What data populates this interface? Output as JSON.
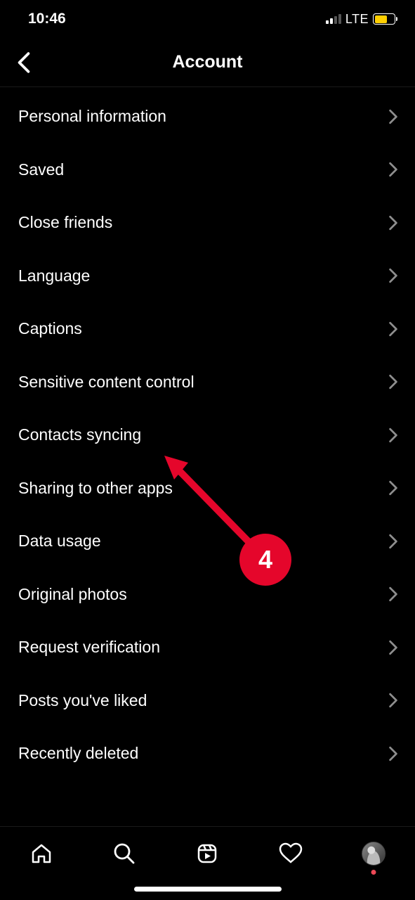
{
  "status": {
    "time": "10:46",
    "network": "LTE"
  },
  "header": {
    "title": "Account"
  },
  "items": [
    {
      "label": "Personal information"
    },
    {
      "label": "Saved"
    },
    {
      "label": "Close friends"
    },
    {
      "label": "Language"
    },
    {
      "label": "Captions"
    },
    {
      "label": "Sensitive content control"
    },
    {
      "label": "Contacts syncing"
    },
    {
      "label": "Sharing to other apps"
    },
    {
      "label": "Data usage"
    },
    {
      "label": "Original photos"
    },
    {
      "label": "Request verification"
    },
    {
      "label": "Posts you've liked"
    },
    {
      "label": "Recently deleted"
    }
  ],
  "annotation": {
    "number": "4"
  }
}
